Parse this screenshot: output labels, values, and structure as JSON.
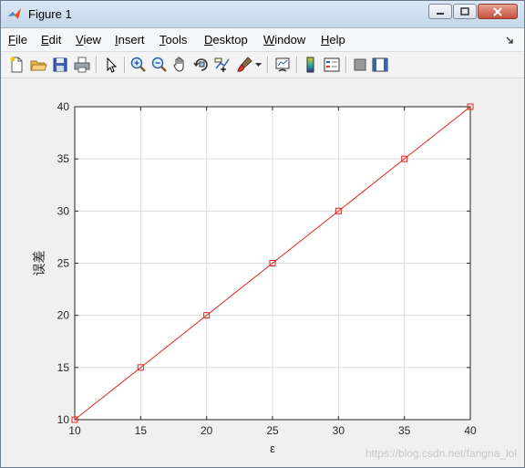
{
  "window": {
    "title": "Figure 1"
  },
  "menu": [
    {
      "label": "File",
      "key": "F",
      "rest": "ile"
    },
    {
      "label": "Edit",
      "key": "E",
      "rest": "dit"
    },
    {
      "label": "View",
      "key": "V",
      "rest": "iew"
    },
    {
      "label": "Insert",
      "key": "I",
      "rest": "nsert"
    },
    {
      "label": "Tools",
      "key": "T",
      "rest": "ools"
    },
    {
      "label": "Desktop",
      "key": "D",
      "rest": "esktop"
    },
    {
      "label": "Window",
      "key": "W",
      "rest": "indow"
    },
    {
      "label": "Help",
      "key": "H",
      "rest": "elp"
    }
  ],
  "toolbar": [
    "new-figure-icon",
    "open-file-icon",
    "save-icon",
    "print-icon",
    "edit-plot-arrow-icon",
    "zoom-in-icon",
    "zoom-out-icon",
    "pan-hand-icon",
    "rotate-3d-icon",
    "data-cursor-icon",
    "brush-icon",
    "link-plot-icon",
    "insert-colorbar-icon",
    "insert-legend-icon",
    "hide-plot-tools-icon",
    "show-plot-tools-icon"
  ],
  "colors": {
    "line": "#e3261f",
    "grid": "#dcdcdc",
    "axes": "#262626"
  },
  "watermark": "https://blog.csdn.net/fangna_lol",
  "chart_data": {
    "type": "line",
    "xlabel": "ε",
    "ylabel": "误差",
    "x": [
      10,
      15,
      20,
      25,
      30,
      35,
      40
    ],
    "series": [
      {
        "values": [
          10,
          15,
          20,
          25,
          30,
          35,
          40
        ],
        "marker": "square"
      }
    ],
    "xlim": [
      10,
      40
    ],
    "ylim": [
      10,
      40
    ],
    "xticks": [
      "10",
      "15",
      "20",
      "25",
      "30",
      "35",
      "40"
    ],
    "yticks": [
      "10",
      "15",
      "20",
      "25",
      "30",
      "35",
      "40"
    ],
    "grid": true
  }
}
